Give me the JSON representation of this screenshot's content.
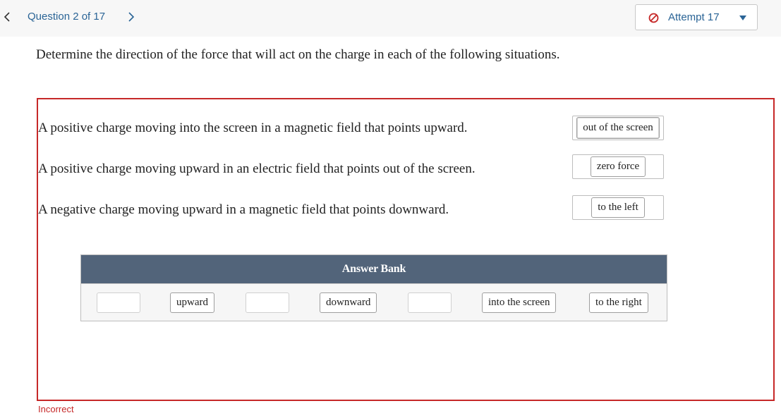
{
  "header": {
    "question_label": "Question 2 of 17",
    "attempt_label": "Attempt 17",
    "link_color": "#2a6496"
  },
  "question": {
    "prompt": "Determine the direction of the force that will act on the charge in each of the following situations."
  },
  "statements": [
    {
      "text": "A positive charge moving into the screen in a magnetic field that points upward.",
      "answer": "out of the screen"
    },
    {
      "text": "A positive charge moving upward in an electric field that points out of the screen.",
      "answer": "zero force"
    },
    {
      "text": "A negative charge moving upward in a magnetic field that points downward.",
      "answer": "to the left"
    }
  ],
  "answer_bank": {
    "title": "Answer Bank",
    "items": [
      "upward",
      "downward",
      "into the screen",
      "to the right"
    ]
  },
  "status": {
    "text": "Incorrect",
    "color": "#c62828"
  }
}
